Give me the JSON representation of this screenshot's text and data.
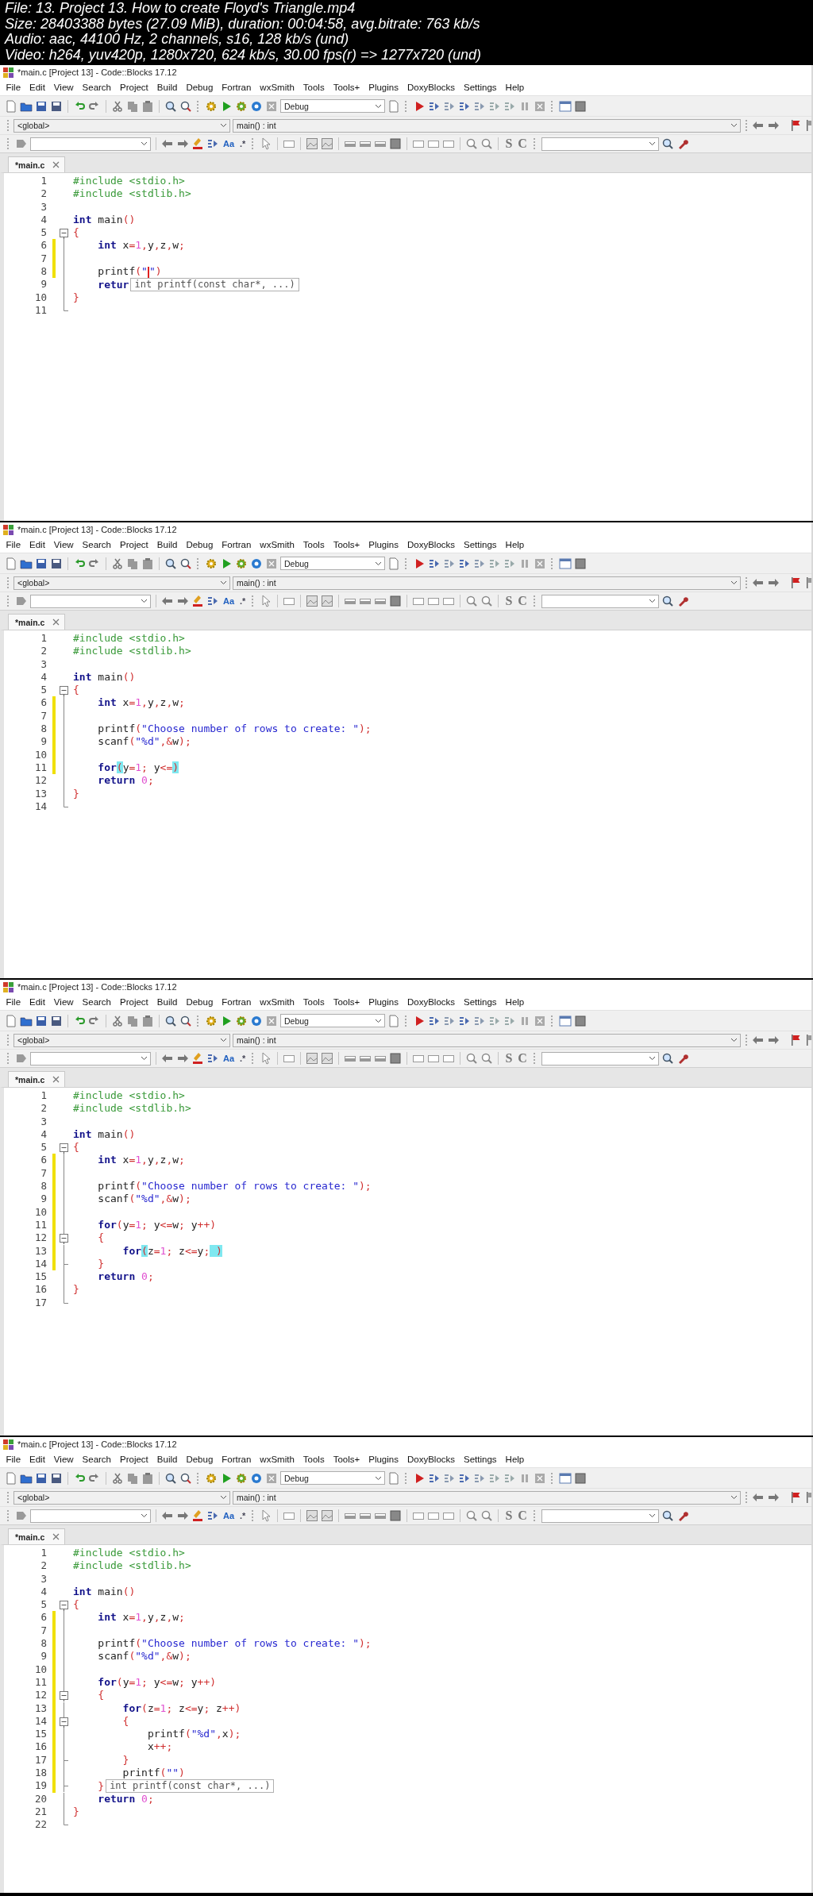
{
  "header": {
    "lines": [
      "File: 13. Project 13. How to create Floyd's Triangle.mp4",
      "Size: 28403388 bytes (27.09 MiB), duration: 00:04:58, avg.bitrate: 763 kb/s",
      "Audio: aac, 44100 Hz, 2 channels, s16, 128 kb/s (und)",
      "Video: h264, yuv420p, 1280x720, 624 kb/s, 30.00 fps(r) => 1277x720 (und)"
    ]
  },
  "frames": [
    {
      "window_title": "*main.c [Project 13] - Code::Blocks 17.12",
      "menu": [
        "File",
        "Edit",
        "View",
        "Search",
        "Project",
        "Build",
        "Debug",
        "Fortran",
        "wxSmith",
        "Tools",
        "Tools+",
        "Plugins",
        "DoxyBlocks",
        "Settings",
        "Help"
      ],
      "build_target": "Debug",
      "scope": "<global>",
      "function": "main() : int",
      "toolbar_glyphs": [
        "Aa",
        ".*",
        "S",
        "C"
      ],
      "tab": "*main.c",
      "lines": [
        {
          "number": "1",
          "changed": false,
          "fold_start": false,
          "fold_end": false,
          "tokens": [
            {
              "kind": "pp",
              "text": "#include <stdio.h>"
            }
          ]
        },
        {
          "number": "2",
          "changed": false,
          "fold_start": false,
          "fold_end": false,
          "tokens": [
            {
              "kind": "pp",
              "text": "#include <stdlib.h>"
            }
          ]
        },
        {
          "number": "3",
          "changed": false,
          "fold_start": false,
          "fold_end": false
        },
        {
          "number": "4",
          "changed": false,
          "fold_start": false,
          "fold_end": false,
          "tokens": [
            {
              "kind": "kw",
              "text": "int"
            },
            {
              "kind": "id",
              "text": " main"
            },
            {
              "kind": "op",
              "text": "()"
            }
          ]
        },
        {
          "number": "5",
          "changed": false,
          "fold_start": true,
          "fold_end": false,
          "tokens": [
            {
              "kind": "op",
              "text": "{"
            }
          ]
        },
        {
          "number": "6",
          "changed": true,
          "fold_start": false,
          "fold_end": false,
          "tokens": [
            {
              "kind": "kw",
              "text": "    int"
            },
            {
              "kind": "id",
              "text": " x"
            },
            {
              "kind": "op",
              "text": "="
            },
            {
              "kind": "num",
              "text": "1"
            },
            {
              "kind": "op",
              "text": ","
            },
            {
              "kind": "id",
              "text": "y"
            },
            {
              "kind": "op",
              "text": ","
            },
            {
              "kind": "id",
              "text": "z"
            },
            {
              "kind": "op",
              "text": ","
            },
            {
              "kind": "id",
              "text": "w"
            },
            {
              "kind": "op",
              "text": ";"
            }
          ]
        },
        {
          "number": "7",
          "changed": true,
          "fold_start": false,
          "fold_end": false
        },
        {
          "number": "8",
          "changed": true,
          "fold_start": false,
          "fold_end": false,
          "tokens": [
            {
              "kind": "id",
              "text": "    printf"
            },
            {
              "kind": "op",
              "text": "("
            },
            {
              "kind": "str",
              "text": "\""
            },
            {
              "kind": "caret"
            },
            {
              "kind": "str",
              "text": "\""
            },
            {
              "kind": "op",
              "text": ")"
            }
          ]
        },
        {
          "number": "9",
          "changed": false,
          "fold_start": false,
          "fold_end": false,
          "tokens": [
            {
              "kind": "kw",
              "text": "    retur"
            }
          ],
          "calltip": "int printf(const char*, ...)"
        },
        {
          "number": "10",
          "changed": false,
          "fold_start": false,
          "fold_end": false,
          "tokens": [
            {
              "kind": "op",
              "text": "}"
            }
          ]
        },
        {
          "number": "11",
          "changed": false,
          "fold_start": false,
          "fold_end": true
        }
      ]
    },
    {
      "window_title": "*main.c [Project 13] - Code::Blocks 17.12",
      "menu": [
        "File",
        "Edit",
        "View",
        "Search",
        "Project",
        "Build",
        "Debug",
        "Fortran",
        "wxSmith",
        "Tools",
        "Tools+",
        "Plugins",
        "DoxyBlocks",
        "Settings",
        "Help"
      ],
      "build_target": "Debug",
      "scope": "<global>",
      "function": "main() : int",
      "toolbar_glyphs": [
        "Aa",
        ".*",
        "S",
        "C"
      ],
      "tab": "*main.c",
      "lines": [
        {
          "number": "1",
          "changed": false,
          "fold_start": false,
          "fold_end": false,
          "tokens": [
            {
              "kind": "pp",
              "text": "#include <stdio.h>"
            }
          ]
        },
        {
          "number": "2",
          "changed": false,
          "fold_start": false,
          "fold_end": false,
          "tokens": [
            {
              "kind": "pp",
              "text": "#include <stdlib.h>"
            }
          ]
        },
        {
          "number": "3",
          "changed": false,
          "fold_start": false,
          "fold_end": false
        },
        {
          "number": "4",
          "changed": false,
          "fold_start": false,
          "fold_end": false,
          "tokens": [
            {
              "kind": "kw",
              "text": "int"
            },
            {
              "kind": "id",
              "text": " main"
            },
            {
              "kind": "op",
              "text": "()"
            }
          ]
        },
        {
          "number": "5",
          "changed": false,
          "fold_start": true,
          "fold_end": false,
          "tokens": [
            {
              "kind": "op",
              "text": "{"
            }
          ]
        },
        {
          "number": "6",
          "changed": true,
          "fold_start": false,
          "fold_end": false,
          "tokens": [
            {
              "kind": "kw",
              "text": "    int"
            },
            {
              "kind": "id",
              "text": " x"
            },
            {
              "kind": "op",
              "text": "="
            },
            {
              "kind": "num",
              "text": "1"
            },
            {
              "kind": "op",
              "text": ","
            },
            {
              "kind": "id",
              "text": "y"
            },
            {
              "kind": "op",
              "text": ","
            },
            {
              "kind": "id",
              "text": "z"
            },
            {
              "kind": "op",
              "text": ","
            },
            {
              "kind": "id",
              "text": "w"
            },
            {
              "kind": "op",
              "text": ";"
            }
          ]
        },
        {
          "number": "7",
          "changed": true,
          "fold_start": false,
          "fold_end": false
        },
        {
          "number": "8",
          "changed": true,
          "fold_start": false,
          "fold_end": false,
          "tokens": [
            {
              "kind": "id",
              "text": "    printf"
            },
            {
              "kind": "op",
              "text": "("
            },
            {
              "kind": "str",
              "text": "\"Choose number of rows to create: \""
            },
            {
              "kind": "op",
              "text": ");"
            }
          ]
        },
        {
          "number": "9",
          "changed": true,
          "fold_start": false,
          "fold_end": false,
          "tokens": [
            {
              "kind": "id",
              "text": "    scanf"
            },
            {
              "kind": "op",
              "text": "("
            },
            {
              "kind": "str",
              "text": "\"%d\""
            },
            {
              "kind": "op",
              "text": ",&"
            },
            {
              "kind": "id",
              "text": "w"
            },
            {
              "kind": "op",
              "text": ");"
            }
          ]
        },
        {
          "number": "10",
          "changed": true,
          "fold_start": false,
          "fold_end": false
        },
        {
          "number": "11",
          "changed": true,
          "fold_start": false,
          "fold_end": false,
          "tokens": [
            {
              "kind": "kw",
              "text": "    for"
            },
            {
              "kind": "match",
              "text": "("
            },
            {
              "kind": "id",
              "text": "y"
            },
            {
              "kind": "op",
              "text": "="
            },
            {
              "kind": "num",
              "text": "1"
            },
            {
              "kind": "op",
              "text": ";"
            },
            {
              "kind": "id",
              "text": " y"
            },
            {
              "kind": "op",
              "text": "<="
            },
            {
              "kind": "match",
              "text": ")"
            }
          ]
        },
        {
          "number": "12",
          "changed": false,
          "fold_start": false,
          "fold_end": false,
          "tokens": [
            {
              "kind": "kw",
              "text": "    return"
            },
            {
              "kind": "num",
              "text": " 0"
            },
            {
              "kind": "op",
              "text": ";"
            }
          ]
        },
        {
          "number": "13",
          "changed": false,
          "fold_start": false,
          "fold_end": false,
          "tokens": [
            {
              "kind": "op",
              "text": "}"
            }
          ]
        },
        {
          "number": "14",
          "changed": false,
          "fold_start": false,
          "fold_end": true
        }
      ]
    },
    {
      "window_title": "*main.c [Project 13] - Code::Blocks 17.12",
      "menu": [
        "File",
        "Edit",
        "View",
        "Search",
        "Project",
        "Build",
        "Debug",
        "Fortran",
        "wxSmith",
        "Tools",
        "Tools+",
        "Plugins",
        "DoxyBlocks",
        "Settings",
        "Help"
      ],
      "build_target": "Debug",
      "scope": "<global>",
      "function": "main() : int",
      "toolbar_glyphs": [
        "Aa",
        ".*",
        "S",
        "C"
      ],
      "tab": "*main.c",
      "lines": [
        {
          "number": "1",
          "changed": false,
          "fold_start": false,
          "fold_end": false,
          "tokens": [
            {
              "kind": "pp",
              "text": "#include <stdio.h>"
            }
          ]
        },
        {
          "number": "2",
          "changed": false,
          "fold_start": false,
          "fold_end": false,
          "tokens": [
            {
              "kind": "pp",
              "text": "#include <stdlib.h>"
            }
          ]
        },
        {
          "number": "3",
          "changed": false,
          "fold_start": false,
          "fold_end": false
        },
        {
          "number": "4",
          "changed": false,
          "fold_start": false,
          "fold_end": false,
          "tokens": [
            {
              "kind": "kw",
              "text": "int"
            },
            {
              "kind": "id",
              "text": " main"
            },
            {
              "kind": "op",
              "text": "()"
            }
          ]
        },
        {
          "number": "5",
          "changed": false,
          "fold_start": true,
          "fold_end": false,
          "tokens": [
            {
              "kind": "op",
              "text": "{"
            }
          ]
        },
        {
          "number": "6",
          "changed": true,
          "fold_start": false,
          "fold_end": false,
          "tokens": [
            {
              "kind": "kw",
              "text": "    int"
            },
            {
              "kind": "id",
              "text": " x"
            },
            {
              "kind": "op",
              "text": "="
            },
            {
              "kind": "num",
              "text": "1"
            },
            {
              "kind": "op",
              "text": ","
            },
            {
              "kind": "id",
              "text": "y"
            },
            {
              "kind": "op",
              "text": ","
            },
            {
              "kind": "id",
              "text": "z"
            },
            {
              "kind": "op",
              "text": ","
            },
            {
              "kind": "id",
              "text": "w"
            },
            {
              "kind": "op",
              "text": ";"
            }
          ]
        },
        {
          "number": "7",
          "changed": true,
          "fold_start": false,
          "fold_end": false
        },
        {
          "number": "8",
          "changed": true,
          "fold_start": false,
          "fold_end": false,
          "tokens": [
            {
              "kind": "id",
              "text": "    printf"
            },
            {
              "kind": "op",
              "text": "("
            },
            {
              "kind": "str",
              "text": "\"Choose number of rows to create: \""
            },
            {
              "kind": "op",
              "text": ");"
            }
          ]
        },
        {
          "number": "9",
          "changed": true,
          "fold_start": false,
          "fold_end": false,
          "tokens": [
            {
              "kind": "id",
              "text": "    scanf"
            },
            {
              "kind": "op",
              "text": "("
            },
            {
              "kind": "str",
              "text": "\"%d\""
            },
            {
              "kind": "op",
              "text": ",&"
            },
            {
              "kind": "id",
              "text": "w"
            },
            {
              "kind": "op",
              "text": ");"
            }
          ]
        },
        {
          "number": "10",
          "changed": true,
          "fold_start": false,
          "fold_end": false
        },
        {
          "number": "11",
          "changed": true,
          "fold_start": false,
          "fold_end": false,
          "tokens": [
            {
              "kind": "kw",
              "text": "    for"
            },
            {
              "kind": "op",
              "text": "("
            },
            {
              "kind": "id",
              "text": "y"
            },
            {
              "kind": "op",
              "text": "="
            },
            {
              "kind": "num",
              "text": "1"
            },
            {
              "kind": "op",
              "text": ";"
            },
            {
              "kind": "id",
              "text": " y"
            },
            {
              "kind": "op",
              "text": "<="
            },
            {
              "kind": "id",
              "text": "w"
            },
            {
              "kind": "op",
              "text": ";"
            },
            {
              "kind": "id",
              "text": " y"
            },
            {
              "kind": "op",
              "text": "++)"
            }
          ]
        },
        {
          "number": "12",
          "changed": true,
          "fold_start": true,
          "fold_end": false,
          "tokens": [
            {
              "kind": "op",
              "text": "    {"
            }
          ]
        },
        {
          "number": "13",
          "changed": true,
          "fold_start": false,
          "fold_end": false,
          "tokens": [
            {
              "kind": "kw",
              "text": "        for"
            },
            {
              "kind": "match",
              "text": "("
            },
            {
              "kind": "id",
              "text": "z"
            },
            {
              "kind": "op",
              "text": "="
            },
            {
              "kind": "num",
              "text": "1"
            },
            {
              "kind": "op",
              "text": ";"
            },
            {
              "kind": "id",
              "text": " z"
            },
            {
              "kind": "op",
              "text": "<="
            },
            {
              "kind": "id",
              "text": "y"
            },
            {
              "kind": "op",
              "text": ";"
            },
            {
              "kind": "match",
              "text": " )"
            }
          ]
        },
        {
          "number": "14",
          "changed": true,
          "fold_start": false,
          "fold_end": true,
          "tokens": [
            {
              "kind": "op",
              "text": "    }"
            }
          ]
        },
        {
          "number": "15",
          "changed": false,
          "fold_start": false,
          "fold_end": false,
          "tokens": [
            {
              "kind": "kw",
              "text": "    return"
            },
            {
              "kind": "num",
              "text": " 0"
            },
            {
              "kind": "op",
              "text": ";"
            }
          ]
        },
        {
          "number": "16",
          "changed": false,
          "fold_start": false,
          "fold_end": false,
          "tokens": [
            {
              "kind": "op",
              "text": "}"
            }
          ]
        },
        {
          "number": "17",
          "changed": false,
          "fold_start": false,
          "fold_end": true
        }
      ]
    },
    {
      "window_title": "*main.c [Project 13] - Code::Blocks 17.12",
      "menu": [
        "File",
        "Edit",
        "View",
        "Search",
        "Project",
        "Build",
        "Debug",
        "Fortran",
        "wxSmith",
        "Tools",
        "Tools+",
        "Plugins",
        "DoxyBlocks",
        "Settings",
        "Help"
      ],
      "build_target": "Debug",
      "scope": "<global>",
      "function": "main() : int",
      "toolbar_glyphs": [
        "Aa",
        ".*",
        "S",
        "C"
      ],
      "tab": "*main.c",
      "lines": [
        {
          "number": "1",
          "changed": false,
          "fold_start": false,
          "fold_end": false,
          "tokens": [
            {
              "kind": "pp",
              "text": "#include <stdio.h>"
            }
          ]
        },
        {
          "number": "2",
          "changed": false,
          "fold_start": false,
          "fold_end": false,
          "tokens": [
            {
              "kind": "pp",
              "text": "#include <stdlib.h>"
            }
          ]
        },
        {
          "number": "3",
          "changed": false,
          "fold_start": false,
          "fold_end": false
        },
        {
          "number": "4",
          "changed": false,
          "fold_start": false,
          "fold_end": false,
          "tokens": [
            {
              "kind": "kw",
              "text": "int"
            },
            {
              "kind": "id",
              "text": " main"
            },
            {
              "kind": "op",
              "text": "()"
            }
          ]
        },
        {
          "number": "5",
          "changed": false,
          "fold_start": true,
          "fold_end": false,
          "tokens": [
            {
              "kind": "op",
              "text": "{"
            }
          ]
        },
        {
          "number": "6",
          "changed": true,
          "fold_start": false,
          "fold_end": false,
          "tokens": [
            {
              "kind": "kw",
              "text": "    int"
            },
            {
              "kind": "id",
              "text": " x"
            },
            {
              "kind": "op",
              "text": "="
            },
            {
              "kind": "num",
              "text": "1"
            },
            {
              "kind": "op",
              "text": ","
            },
            {
              "kind": "id",
              "text": "y"
            },
            {
              "kind": "op",
              "text": ","
            },
            {
              "kind": "id",
              "text": "z"
            },
            {
              "kind": "op",
              "text": ","
            },
            {
              "kind": "id",
              "text": "w"
            },
            {
              "kind": "op",
              "text": ";"
            }
          ]
        },
        {
          "number": "7",
          "changed": true,
          "fold_start": false,
          "fold_end": false
        },
        {
          "number": "8",
          "changed": true,
          "fold_start": false,
          "fold_end": false,
          "tokens": [
            {
              "kind": "id",
              "text": "    printf"
            },
            {
              "kind": "op",
              "text": "("
            },
            {
              "kind": "str",
              "text": "\"Choose number of rows to create: \""
            },
            {
              "kind": "op",
              "text": ");"
            }
          ]
        },
        {
          "number": "9",
          "changed": true,
          "fold_start": false,
          "fold_end": false,
          "tokens": [
            {
              "kind": "id",
              "text": "    scanf"
            },
            {
              "kind": "op",
              "text": "("
            },
            {
              "kind": "str",
              "text": "\"%d\""
            },
            {
              "kind": "op",
              "text": ",&"
            },
            {
              "kind": "id",
              "text": "w"
            },
            {
              "kind": "op",
              "text": ");"
            }
          ]
        },
        {
          "number": "10",
          "changed": true,
          "fold_start": false,
          "fold_end": false
        },
        {
          "number": "11",
          "changed": true,
          "fold_start": false,
          "fold_end": false,
          "tokens": [
            {
              "kind": "kw",
              "text": "    for"
            },
            {
              "kind": "op",
              "text": "("
            },
            {
              "kind": "id",
              "text": "y"
            },
            {
              "kind": "op",
              "text": "="
            },
            {
              "kind": "num",
              "text": "1"
            },
            {
              "kind": "op",
              "text": ";"
            },
            {
              "kind": "id",
              "text": " y"
            },
            {
              "kind": "op",
              "text": "<="
            },
            {
              "kind": "id",
              "text": "w"
            },
            {
              "kind": "op",
              "text": ";"
            },
            {
              "kind": "id",
              "text": " y"
            },
            {
              "kind": "op",
              "text": "++)"
            }
          ]
        },
        {
          "number": "12",
          "changed": true,
          "fold_start": true,
          "fold_end": false,
          "tokens": [
            {
              "kind": "op",
              "text": "    {"
            }
          ]
        },
        {
          "number": "13",
          "changed": true,
          "fold_start": false,
          "fold_end": false,
          "tokens": [
            {
              "kind": "kw",
              "text": "        for"
            },
            {
              "kind": "op",
              "text": "("
            },
            {
              "kind": "id",
              "text": "z"
            },
            {
              "kind": "op",
              "text": "="
            },
            {
              "kind": "num",
              "text": "1"
            },
            {
              "kind": "op",
              "text": ";"
            },
            {
              "kind": "id",
              "text": " z"
            },
            {
              "kind": "op",
              "text": "<="
            },
            {
              "kind": "id",
              "text": "y"
            },
            {
              "kind": "op",
              "text": ";"
            },
            {
              "kind": "id",
              "text": " z"
            },
            {
              "kind": "op",
              "text": "++)"
            }
          ]
        },
        {
          "number": "14",
          "changed": true,
          "fold_start": true,
          "fold_end": false,
          "tokens": [
            {
              "kind": "op",
              "text": "        {"
            }
          ]
        },
        {
          "number": "15",
          "changed": true,
          "fold_start": false,
          "fold_end": false,
          "tokens": [
            {
              "kind": "id",
              "text": "            printf"
            },
            {
              "kind": "op",
              "text": "("
            },
            {
              "kind": "str",
              "text": "\"%d\""
            },
            {
              "kind": "op",
              "text": ","
            },
            {
              "kind": "id",
              "text": "x"
            },
            {
              "kind": "op",
              "text": ");"
            }
          ]
        },
        {
          "number": "16",
          "changed": true,
          "fold_start": false,
          "fold_end": false,
          "tokens": [
            {
              "kind": "id",
              "text": "            x"
            },
            {
              "kind": "op",
              "text": "++;"
            }
          ]
        },
        {
          "number": "17",
          "changed": true,
          "fold_start": false,
          "fold_end": true,
          "tokens": [
            {
              "kind": "op",
              "text": "        }"
            }
          ]
        },
        {
          "number": "18",
          "changed": true,
          "fold_start": false,
          "fold_end": false,
          "tokens": [
            {
              "kind": "id",
              "text": "        printf"
            },
            {
              "kind": "op",
              "text": "("
            },
            {
              "kind": "str",
              "text": "\"\""
            },
            {
              "kind": "op",
              "text": ")"
            }
          ]
        },
        {
          "number": "19",
          "changed": true,
          "fold_start": false,
          "fold_end": true,
          "tokens": [
            {
              "kind": "op",
              "text": "    }"
            }
          ],
          "calltip": "int printf(const char*, ...)"
        },
        {
          "number": "20",
          "changed": false,
          "fold_start": false,
          "fold_end": false,
          "tokens": [
            {
              "kind": "kw",
              "text": "    return"
            },
            {
              "kind": "num",
              "text": " 0"
            },
            {
              "kind": "op",
              "text": ";"
            }
          ]
        },
        {
          "number": "21",
          "changed": false,
          "fold_start": false,
          "fold_end": false,
          "tokens": [
            {
              "kind": "op",
              "text": "}"
            }
          ]
        },
        {
          "number": "22",
          "changed": false,
          "fold_start": false,
          "fold_end": true
        }
      ]
    }
  ]
}
